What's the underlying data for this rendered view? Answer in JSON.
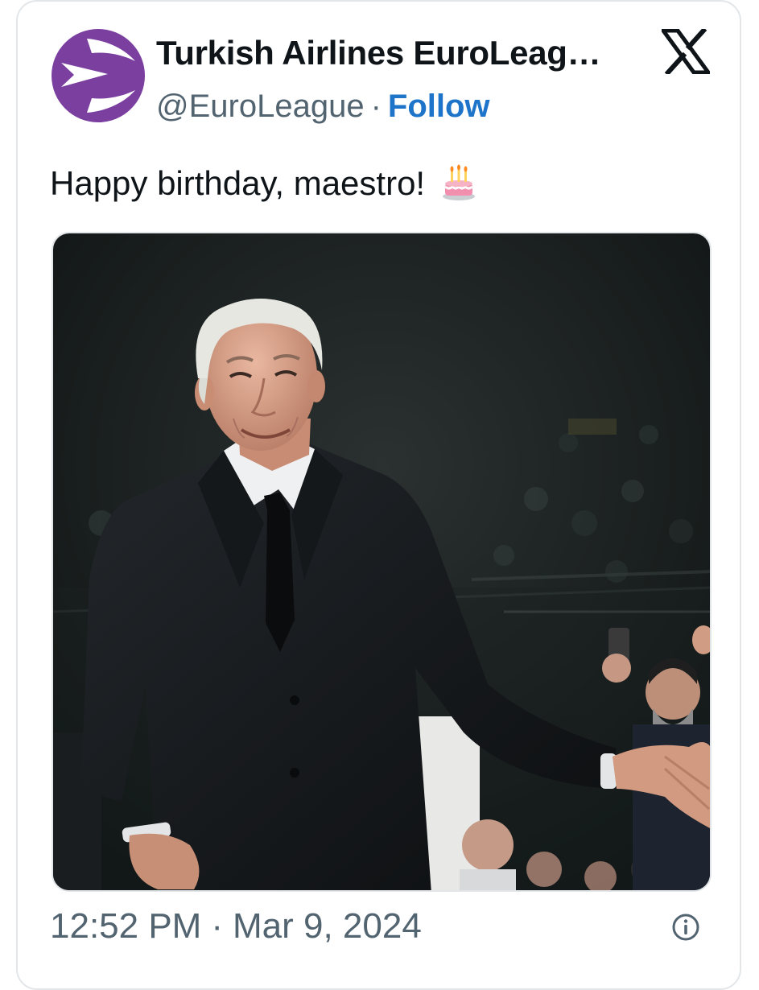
{
  "tweet": {
    "display_name": "Turkish Airlines EuroLeag…",
    "handle": "@EuroLeague",
    "separator": "·",
    "follow_label": "Follow",
    "text": "Happy birthday, maestro!",
    "emoji_icon": "birthday-cake-icon",
    "time": "12:52 PM",
    "date": "Mar 9, 2024"
  },
  "icons": {
    "avatar": "euroleague-logo",
    "platform": "x-logo",
    "info": "info-icon"
  },
  "colors": {
    "brand_purple": "#7b3fa0",
    "follow_blue": "#1d74c9",
    "text_primary": "#0f1419",
    "text_secondary": "#536471",
    "border": "#e3e6e9"
  }
}
